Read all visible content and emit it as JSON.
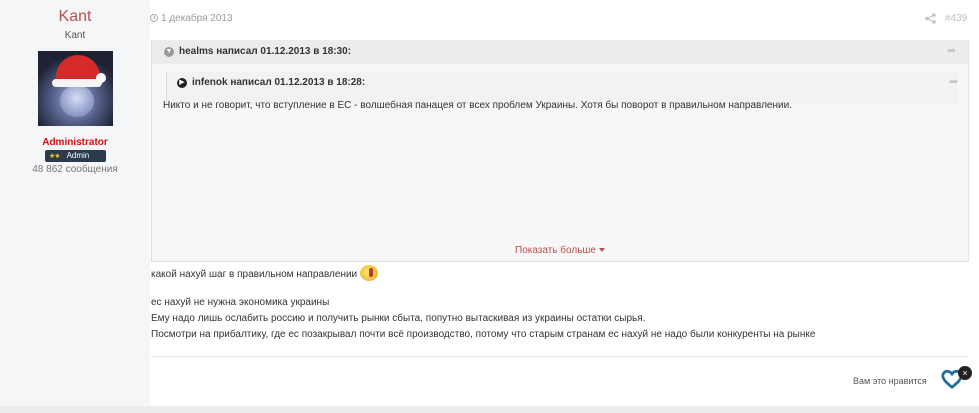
{
  "author": {
    "name": "Kant",
    "title": "Kant",
    "group": "Administrator",
    "badge_stars": "★★",
    "badge_label": "Admin",
    "post_count": "48 862 сообщения"
  },
  "post": {
    "date": "1 декабря 2013",
    "number": "#439"
  },
  "quote_outer": {
    "author_line": "healms написал 01.12.2013 в 18:30:"
  },
  "quote_inner": {
    "author_line": "infenok написал 01.12.2013 в 18:28:",
    "text": "Никто и не говорит, что вступление в ЕС - волшебная панацея от всех проблем Украины. Хотя бы поворот в правильном направлении."
  },
  "show_more_label": "Показать больше",
  "body_lines": [
    "какой нахуй шаг в правильном направлении",
    "ес нахуй не нужна экономика украины",
    "Ему надо лишь ослабить россию и получить рынки сбыта, попутно вытаскивая из украины остатки сырья.",
    "Посмотри на прибалтику, где ес позакрывал почти всё производство, потому что старым странам ес нахуй не надо были конкуренты на рынке"
  ],
  "like": {
    "label": "Вам это нравится",
    "close_glyph": "×"
  },
  "icons": {
    "quote_collapse": "chevron-down-icon",
    "quote_expand": "chevron-right-icon",
    "jump_to_quote": "share-arrow-icon",
    "post_share": "share-icon",
    "like": "heart-icon"
  },
  "colors": {
    "author_name": "#b74f4f",
    "group": "#d01010",
    "like_heart": "#1f6f9a"
  }
}
